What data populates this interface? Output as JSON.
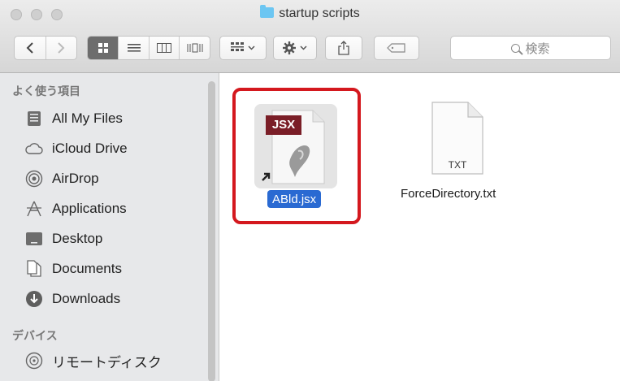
{
  "window": {
    "title": "startup scripts"
  },
  "toolbar": {
    "search_placeholder": "検索"
  },
  "sidebar": {
    "favorites_header": "よく使う項目",
    "devices_header": "デバイス",
    "items": [
      {
        "label": "All My Files",
        "icon": "all-my-files-icon"
      },
      {
        "label": "iCloud Drive",
        "icon": "cloud-icon"
      },
      {
        "label": "AirDrop",
        "icon": "airdrop-icon"
      },
      {
        "label": "Applications",
        "icon": "applications-icon"
      },
      {
        "label": "Desktop",
        "icon": "desktop-icon"
      },
      {
        "label": "Documents",
        "icon": "documents-icon"
      },
      {
        "label": "Downloads",
        "icon": "downloads-icon"
      }
    ],
    "devices": [
      {
        "label": "リモートディスク",
        "icon": "remote-disc-icon"
      }
    ]
  },
  "files": [
    {
      "name": "ABld.jsx",
      "badge": "JSX",
      "selected": true,
      "alias": true
    },
    {
      "name": "ForceDirectory.txt",
      "badge": "TXT",
      "selected": false,
      "alias": false
    }
  ],
  "colors": {
    "highlight": "#d4181e",
    "selection": "#2a6ad2",
    "jsx_badge": "#7a1e27"
  }
}
